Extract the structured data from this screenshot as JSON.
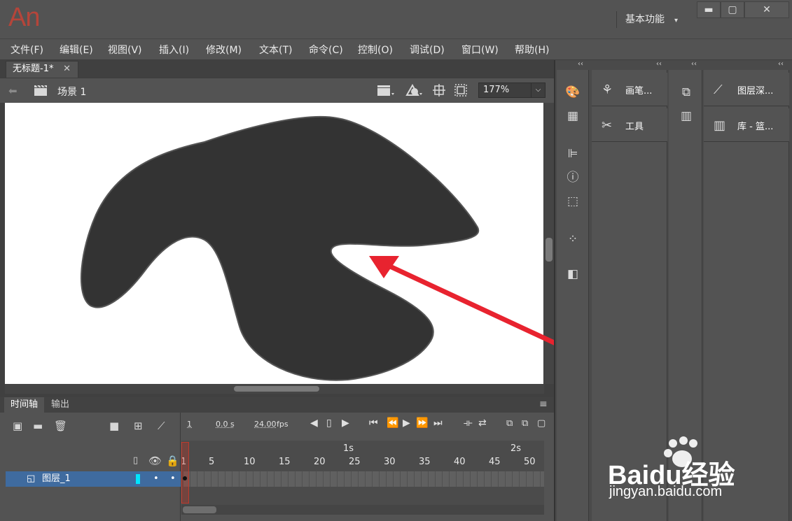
{
  "app": {
    "logo_text": "An",
    "workspace": "基本功能",
    "workspace_caret": "▾"
  },
  "window_controls": {
    "minimize": "▬",
    "restore": "▢",
    "close": "✕"
  },
  "menu": [
    "文件(F)",
    "编辑(E)",
    "视图(V)",
    "插入(I)",
    "修改(M)",
    "文本(T)",
    "命令(C)",
    "控制(O)",
    "调试(D)",
    "窗口(W)",
    "帮助(H)"
  ],
  "document": {
    "tab_title": "无标题-1*",
    "close_glyph": "✕",
    "scene": "场景 1",
    "zoom": "177%"
  },
  "right_panels": {
    "collapse_glyph": "‹‹",
    "col1_buttons": [
      {
        "label": "画笔...",
        "icon": "brush-icon"
      },
      {
        "label": "工具",
        "icon": "tools-icon"
      }
    ],
    "col2_buttons": [
      {
        "label": "图层深...",
        "icon": "layer-depth-icon"
      },
      {
        "label": "库 - 篮...",
        "icon": "library-icon"
      }
    ]
  },
  "timeline": {
    "tabs": [
      "时间轴",
      "输出"
    ],
    "frame": "1",
    "time": "0.0 s",
    "fps_value": "24.00",
    "fps_unit": "fps",
    "second_marks": [
      "1s",
      "2s"
    ],
    "frame_numbers": [
      "1",
      "5",
      "10",
      "15",
      "20",
      "25",
      "30",
      "35",
      "40",
      "45",
      "50"
    ],
    "layer_name": "图层_1",
    "layer_dot": "•"
  },
  "watermark": {
    "brand": "Baidu经验",
    "url": "jingyan.baidu.com"
  },
  "colors": {
    "accent_red": "#e8232f",
    "shape_fill": "#333333",
    "layer_highlight": "#3f6b9f",
    "logo": "#b5453a"
  }
}
